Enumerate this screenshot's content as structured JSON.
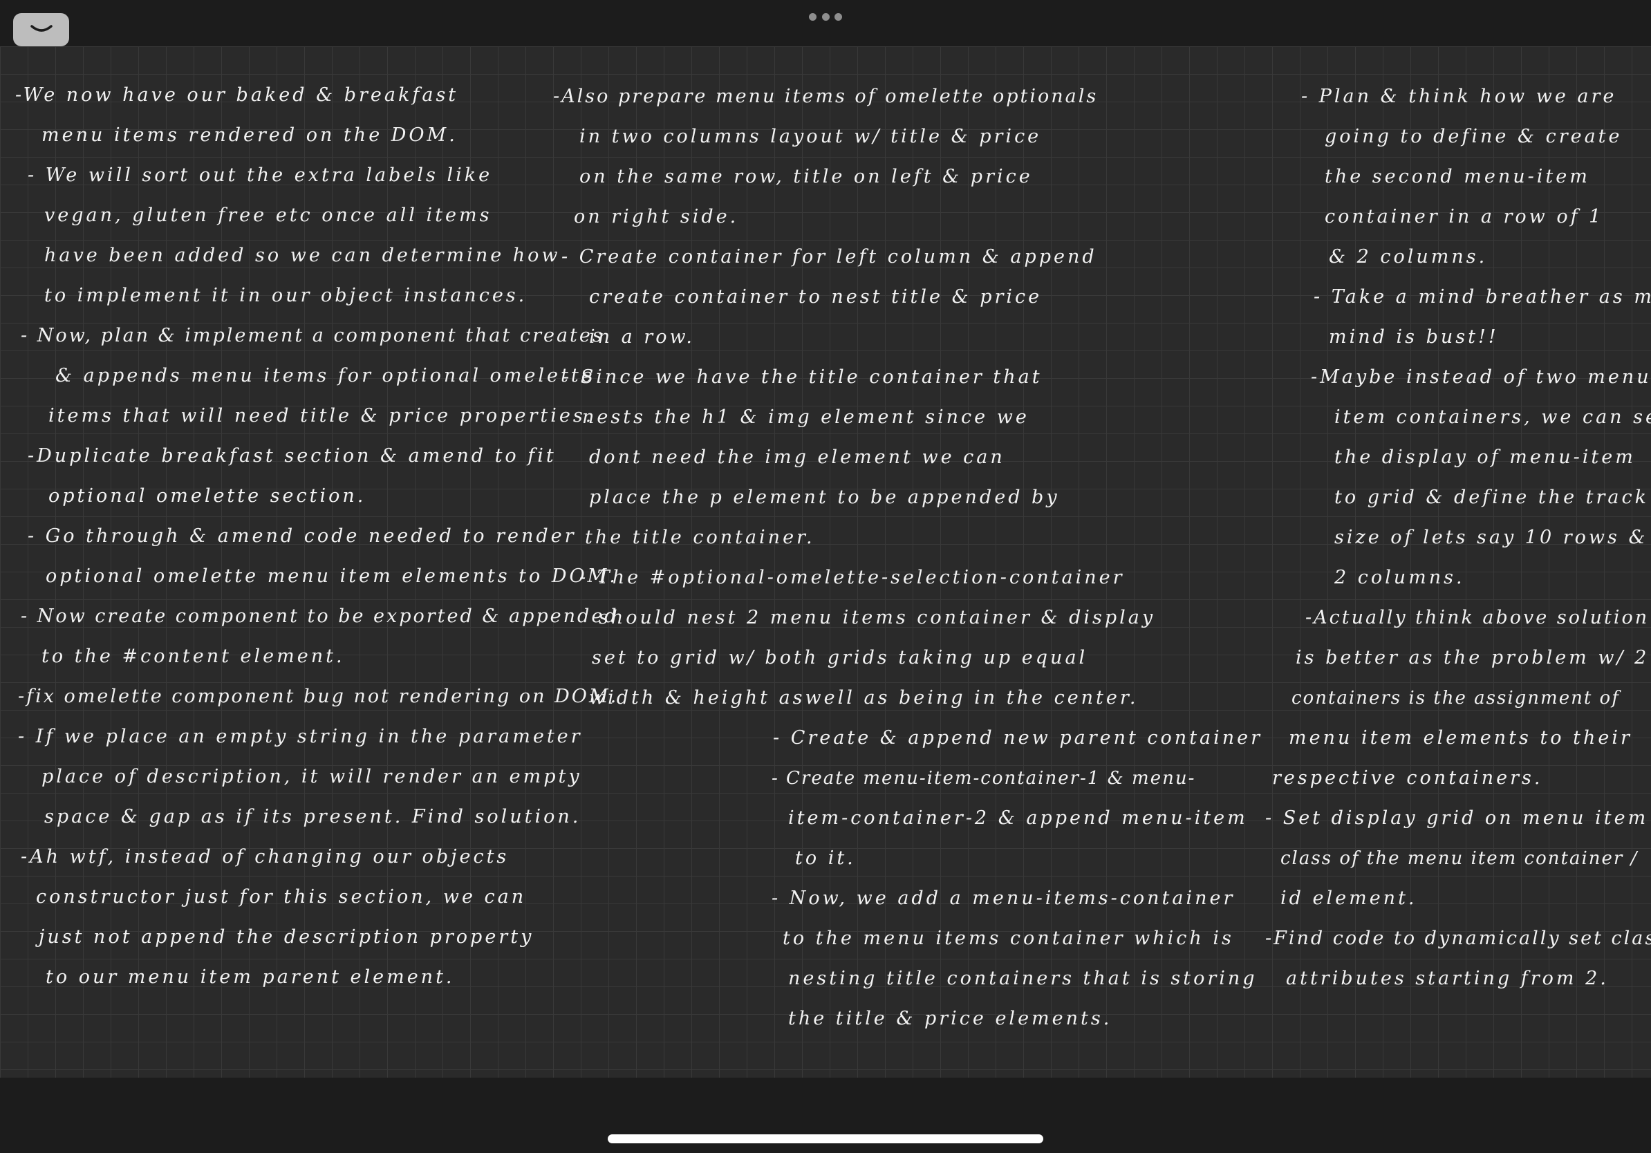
{
  "toolbar": {
    "collapse_icon": "chevron-down-icon",
    "more_icon": "more-dots-icon"
  },
  "notes": {
    "column1": [
      "-We now have our baked & breakfast",
      "menu items rendered on the DOM.",
      "- We will sort out the extra labels like",
      "vegan, gluten free etc once all items",
      "have been added so we can determine how",
      "to implement it in our object instances.",
      "- Now, plan & implement a component that creates",
      "& appends menu items for optional omelette",
      "items that will need title & price properties.",
      "-Duplicate breakfast section & amend to fit",
      "optional omelette section.",
      "- Go through & amend code needed to render",
      "optional omelette menu item elements to DOM.",
      "- Now create component to be exported & appended",
      "to the #content element.",
      "-fix omelette component bug not rendering on DOM.",
      "- If we place an empty string in the parameter",
      "place of description, it will render an empty",
      "space & gap as if its present. Find solution.",
      "-Ah wtf, instead of changing our objects",
      "constructor just for this section, we can",
      "just not append the description property",
      "to our menu item parent element."
    ],
    "column2": [
      "-Also prepare menu items of omelette optionals",
      "in two columns layout w/ title & price",
      "on the same row, title on left & price",
      "on right side.",
      "- Create container for left column & append",
      "create container to nest title & price",
      "in a row.",
      "- Since we have the title container that",
      "nests the h1 & img element since we",
      "dont need the img element we can",
      "place the p element to be appended by",
      "the title container.",
      "- The #optional-omelette-selection-container",
      "should nest 2 menu items container & display",
      "set to grid w/ both grids taking up equal",
      "width & height aswell as being in the center.",
      "- Create & append new parent container",
      "- Create menu-item-container-1 & menu-",
      "item-container-2 & append menu-item",
      "to it.",
      "- Now, we add a menu-items-container",
      "to the menu items container which is",
      "nesting title containers that is storing",
      "the title & price elements."
    ],
    "column3": [
      "- Plan & think how we are",
      "going to define & create",
      "the second menu-item",
      "container in a row of 1",
      "& 2 columns.",
      "- Take a mind breather as my",
      "mind is bust!!",
      "-Maybe instead of two menu",
      "item containers, we can set",
      "the display of menu-item",
      "to grid & define the track",
      "size of lets say 10 rows &",
      "2 columns.",
      "-Actually think above solution",
      "is better as the problem w/ 2",
      "containers is the assignment of",
      "menu item elements to their",
      "respective containers.",
      "- Set display grid on menu item",
      "class of the menu item container /",
      "id element.",
      "-Find code to dynamically set class",
      "attributes starting from 2."
    ]
  },
  "colors": {
    "page_background": "#2a2a2a",
    "chrome_background": "#1c1c1c",
    "ink": "#f2f2f2",
    "spellcheck_underline": "#e0322b"
  }
}
